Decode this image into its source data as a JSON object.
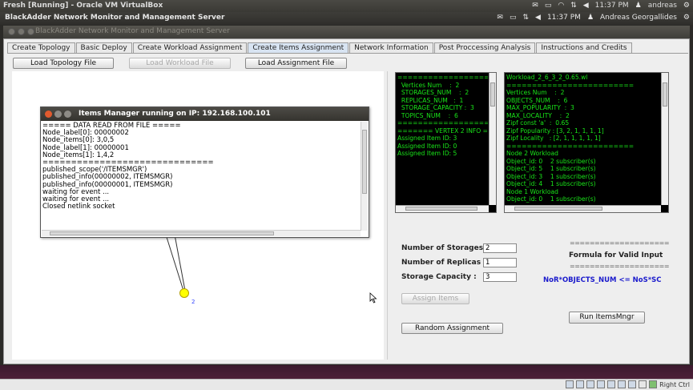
{
  "host": {
    "title": "Fresh [Running] - Oracle VM VirtualBox",
    "time": "11:37 PM",
    "user": "andreas"
  },
  "guest": {
    "title": "BlackAdder Network Monitor and Management Server",
    "time": "11:37 PM",
    "user": "Andreas Georgallides"
  },
  "window": {
    "title": "BlackAdder Network Monitor and Management Server"
  },
  "tabs": [
    {
      "label": "Create Topology"
    },
    {
      "label": "Basic Deploy"
    },
    {
      "label": "Create Workload Assignment"
    },
    {
      "label": "Create Items Assignment"
    },
    {
      "label": "Network Information"
    },
    {
      "label": "Post Proccessing Analysis"
    },
    {
      "label": "Instructions and Credits"
    }
  ],
  "toolbar": {
    "load_topology": "Load Topology File",
    "load_workload": "Load Workload File",
    "load_assignment": "Load Assignment File"
  },
  "items_manager": {
    "title": "Items Manager running on IP: 192.168.100.101",
    "lines": [
      "===== DATA READ FROM FILE =====",
      "Node_label[0]: 00000002",
      "Node_items[0]: 3,0,5",
      "Node_label[1]: 00000001",
      "Node_items[1]: 1,4,2",
      "==============================",
      "",
      "published_scope('/ITEMSMGR')",
      "published_info(00000002, ITEMSMGR)",
      "published_info(00000001, ITEMSMGR)",
      "waiting for event ...",
      "waiting for event ...",
      "Closed netlink socket"
    ]
  },
  "graph": {
    "node_label": "2"
  },
  "console_left": {
    "lines": [
      "=========================",
      "  Vertices Num    :  2",
      "  STORAGES_NUM    :  2",
      "  REPLICAS_NUM   :  1",
      "  STORAGE_CAPACITY :  3",
      "  TOPICS_NUM    :  6",
      "=========================",
      "",
      "======= VERTEX 2 INFO =======",
      "Assigned Item ID: 3",
      "Assigned Item ID: 0",
      "Assigned Item ID: 5"
    ]
  },
  "console_right": {
    "lines": [
      "Workload_2_6_3_2_0.65.wl",
      "=========================",
      "Vertices Num    :  2",
      "OBJECTS_NUM    :  6",
      "MAX_POPULARITY  :  3",
      "MAX_LOCALITY    :  2",
      "Zipf const 'a'  :  0.65",
      "Zipf Popularity : [3, 2, 1, 1, 1, 1]",
      "Zipf Locality   : [2, 1, 1, 1, 1, 1]",
      "=========================",
      "",
      "Node 2 Workload",
      "Object_id: 0    2 subscriber(s)",
      "Object_id: 5    1 subscriber(s)",
      "Object_id: 3    1 subscriber(s)",
      "Object_id: 4    1 subscriber(s)",
      "Node 1 Workload",
      "Object_id: 0    1 subscriber(s)"
    ]
  },
  "form": {
    "storages_label": "Number of Storages:",
    "storages_value": "2",
    "replicas_label": "Number of Replicas :",
    "replicas_value": "1",
    "capacity_label": "Storage Capacity   :",
    "capacity_value": "3",
    "assign_items": "Assign Items",
    "random_assignment": "Random Assignment",
    "run_items_mngr": "Run ItemsMngr"
  },
  "formula": {
    "dashes": "====================",
    "title": "Formula for Valid Input",
    "expression": "NoR*OBJECTS_NUM <= NoS*SC"
  },
  "statusbar": {
    "right_ctrl": "Right Ctrl"
  }
}
